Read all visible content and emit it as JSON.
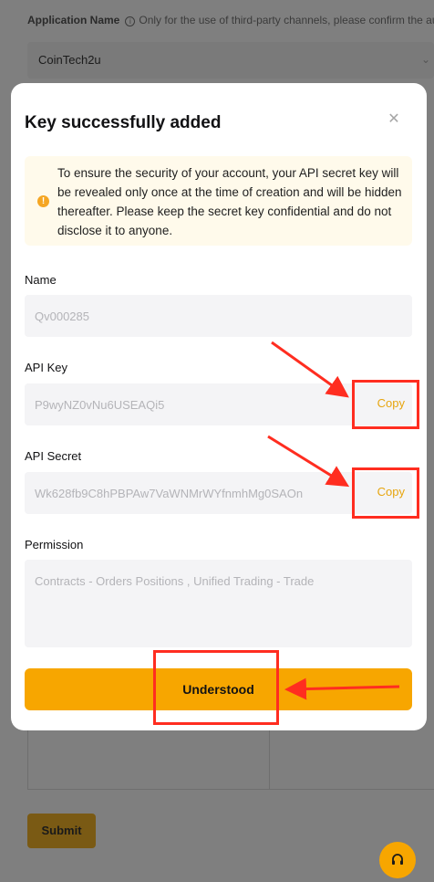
{
  "background": {
    "app_name_label": "Application Name",
    "app_name_hint": "Only for the use of third-party channels, please confirm the authenticity",
    "app_name_value": "CoinTech2u",
    "submit_label": "Submit"
  },
  "modal": {
    "title": "Key successfully added",
    "notice": "To ensure the security of your account, your API secret key will be revealed only once at the time of creation and will be hidden thereafter. Please keep the secret key confidential and do not disclose it to anyone.",
    "name_label": "Name",
    "name_value": "Qv000285",
    "api_key_label": "API Key",
    "api_key_value": "P9wyNZ0vNu6USEAQi5",
    "api_secret_label": "API Secret",
    "api_secret_value": "Wk628fb9C8hPBPAw7VaWNMrWYfnmhMg0SAOn",
    "copy_label": "Copy",
    "permission_label": "Permission",
    "permission_value": "Contracts - Orders Positions  , Unified Trading - Trade",
    "understood_label": "Understood"
  },
  "colors": {
    "accent": "#f7a600",
    "copy_text": "#e7a50e",
    "annotation_red": "#ff2d20",
    "notice_bg": "#fffaeb"
  },
  "icons": [
    "info-icon",
    "close-icon",
    "warning-icon",
    "headset-icon",
    "chevron-down-icon"
  ]
}
